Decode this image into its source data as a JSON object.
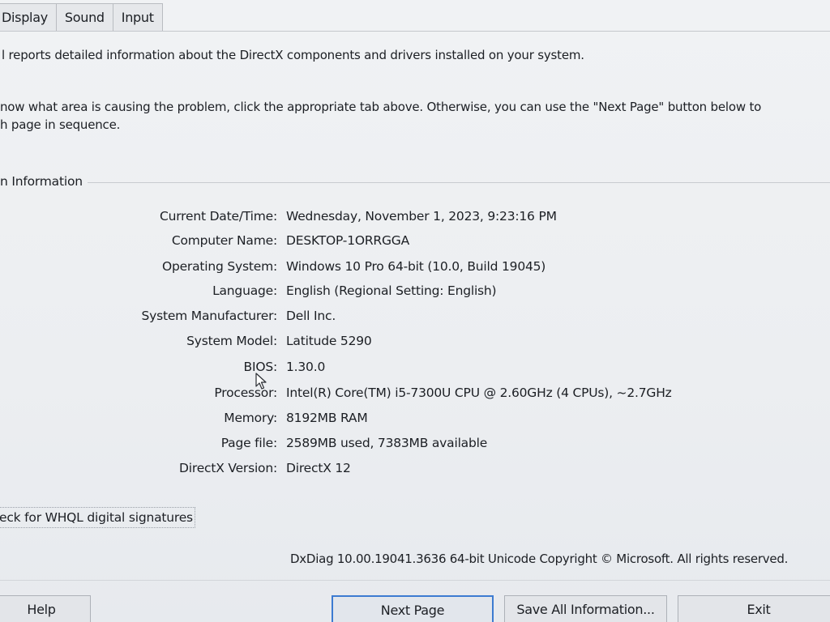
{
  "tabs": [
    "Display",
    "Sound",
    "Input"
  ],
  "intro": {
    "line1": "l reports detailed information about the DirectX components and drivers installed on your system.",
    "line2": "now what area is causing the problem, click the appropriate tab above.  Otherwise, you can use the \"Next Page\" button below to",
    "line3": "h page in sequence."
  },
  "system_info": {
    "group_label": "n Information",
    "rows": [
      {
        "label": "Current Date/Time:",
        "value": "Wednesday, November 1, 2023, 9:23:16 PM"
      },
      {
        "label": "Computer Name:",
        "value": "DESKTOP-1ORRGGA"
      },
      {
        "label": "Operating System:",
        "value": "Windows 10 Pro 64-bit (10.0, Build 19045)"
      },
      {
        "label": "Language:",
        "value": "English (Regional Setting: English)"
      },
      {
        "label": "System Manufacturer:",
        "value": "Dell Inc."
      },
      {
        "label": "System Model:",
        "value": "Latitude 5290"
      },
      {
        "label": "BIOS:",
        "value": "1.30.0"
      },
      {
        "label": "Processor:",
        "value": "Intel(R) Core(TM) i5-7300U CPU @ 2.60GHz (4 CPUs), ~2.7GHz"
      },
      {
        "label": "Memory:",
        "value": "8192MB RAM"
      },
      {
        "label": "Page file:",
        "value": "2589MB used, 7383MB available"
      },
      {
        "label": "DirectX Version:",
        "value": "DirectX 12"
      }
    ]
  },
  "whql_checkbox": {
    "label": "eck for WHQL digital signatures"
  },
  "footer": {
    "copyright": "DxDiag 10.00.19041.3636 64-bit Unicode  Copyright © Microsoft. All rights reserved."
  },
  "buttons": {
    "help": "Help",
    "next_page": "Next Page",
    "save_all": "Save All Information...",
    "exit": "Exit"
  },
  "colors": {
    "window_bg": "#eceef0",
    "focus_border": "#3d7bd1"
  }
}
